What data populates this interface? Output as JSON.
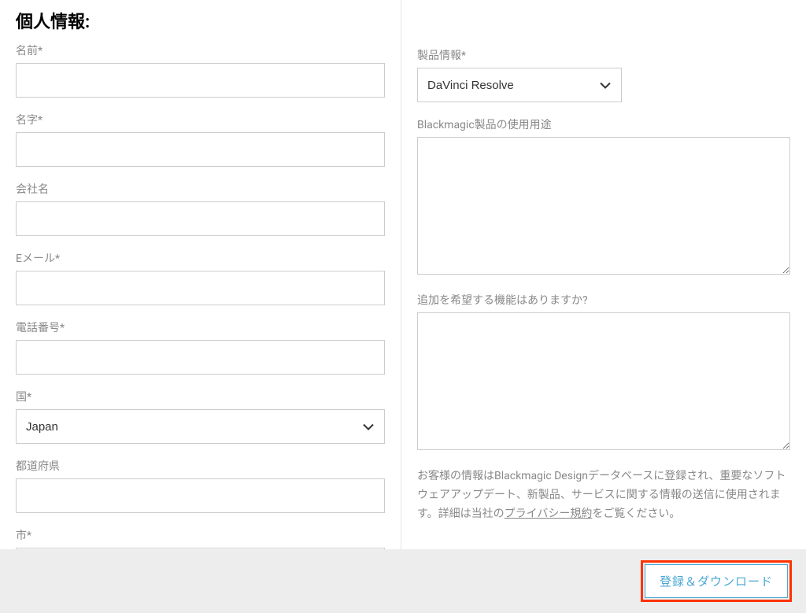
{
  "sectionTitle": "個人情報:",
  "leftFields": {
    "firstName": {
      "label": "名前*",
      "value": ""
    },
    "lastName": {
      "label": "名字*",
      "value": ""
    },
    "company": {
      "label": "会社名",
      "value": ""
    },
    "email": {
      "label": "Eメール*",
      "value": ""
    },
    "phone": {
      "label": "電話番号*",
      "value": ""
    },
    "country": {
      "label": "国*",
      "selected": "Japan"
    },
    "prefecture": {
      "label": "都道府県",
      "value": ""
    },
    "city": {
      "label": "市*",
      "value": ""
    }
  },
  "rightFields": {
    "productInfo": {
      "label": "製品情報*",
      "selected": "DaVinci Resolve"
    },
    "usage": {
      "label": "Blackmagic製品の使用用途",
      "value": ""
    },
    "features": {
      "label": "追加を希望する機能はありますか?",
      "value": ""
    }
  },
  "privacy": {
    "prefix": "お客様の情報はBlackmagic Designデータベースに登録され、重要なソフトウェアアップデート、新製品、サービスに関する情報の送信に使用されます。詳細は当社の",
    "link": "プライバシー規約",
    "suffix": "をご覧ください。"
  },
  "submitLabel": "登録＆ダウンロード"
}
